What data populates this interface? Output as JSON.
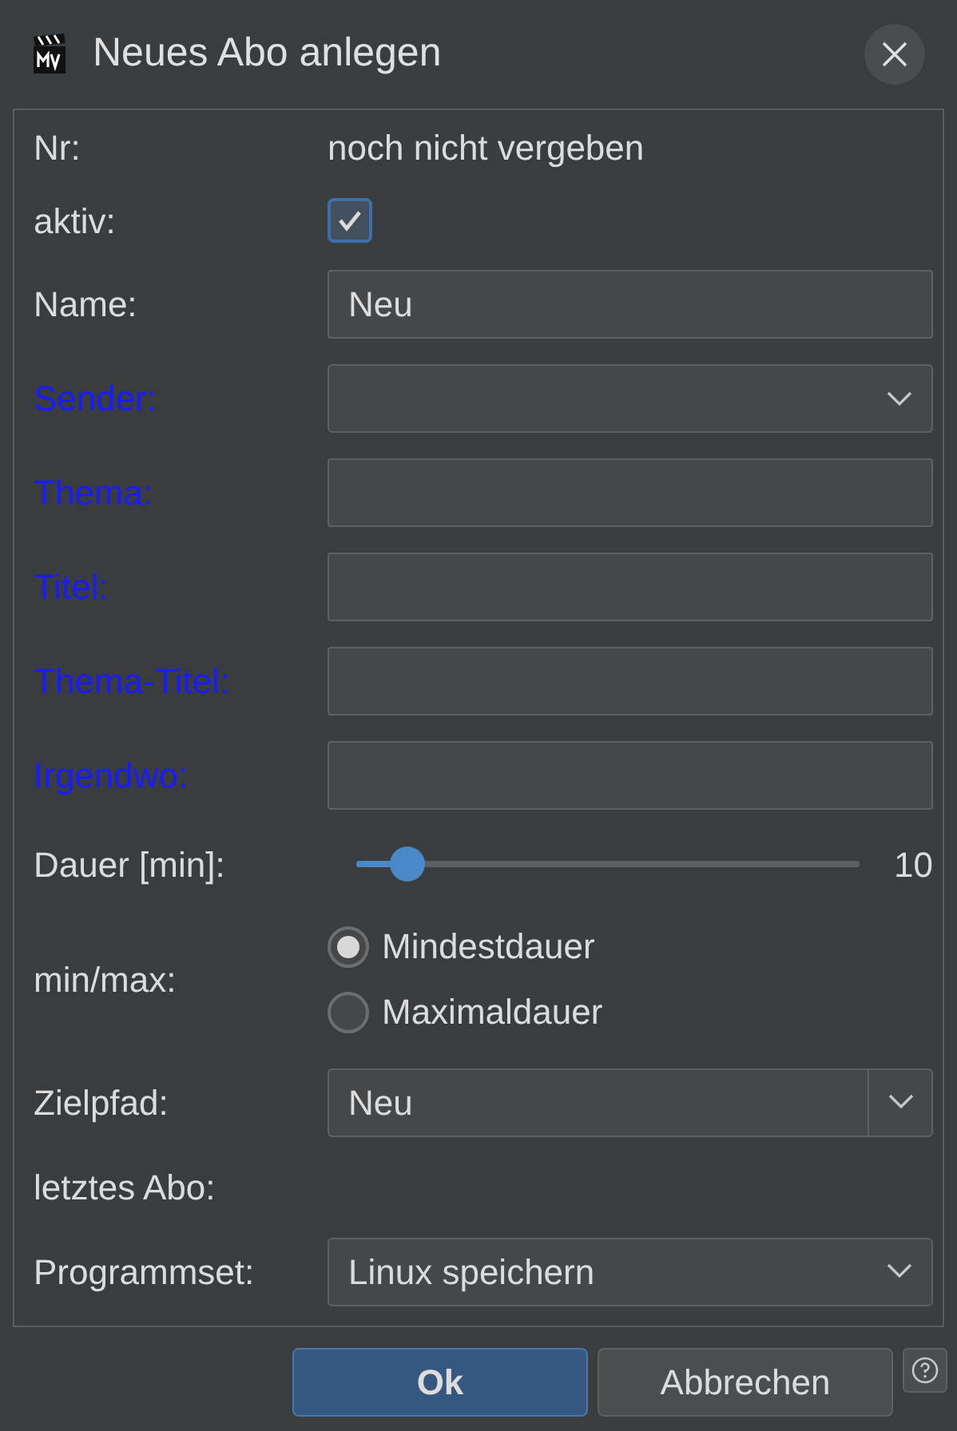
{
  "window": {
    "title": "Neues Abo anlegen"
  },
  "info_rows": [
    {
      "label": "Nr:",
      "value": "noch nicht vergeben"
    }
  ],
  "active": {
    "label": "aktiv:",
    "checked": true
  },
  "fields": [
    {
      "label": "Name:",
      "highlighted": false,
      "kind": "text",
      "value": "Neu"
    },
    {
      "label": "Sender:",
      "highlighted": true,
      "kind": "combo"
    },
    {
      "label": "Thema:",
      "highlighted": true,
      "kind": "text"
    },
    {
      "label": "Titel:",
      "highlighted": true,
      "kind": "text"
    },
    {
      "label": "Thema-Titel:",
      "highlighted": true,
      "kind": "text"
    },
    {
      "label": "Irgendwo:",
      "highlighted": true,
      "kind": "text"
    }
  ],
  "duration": {
    "label": "Dauer [min]:",
    "level": 0.1,
    "reading": "10"
  },
  "min_max": {
    "label": "min/max:",
    "options": [
      {
        "label": "Mindestdauer",
        "selected": true
      },
      {
        "label": "Maximaldauer",
        "selected": false
      }
    ]
  },
  "target_path": {
    "label": "Zielpfad:",
    "value": "Neu"
  },
  "last_abo": {
    "label": "letztes Abo:"
  },
  "program_set": {
    "label": "Programmset:",
    "value": "Linux speichern"
  },
  "buttons": [
    {
      "label": "Ok",
      "kind": "primary"
    },
    {
      "label": "Abbrechen",
      "kind": "secondary"
    }
  ]
}
